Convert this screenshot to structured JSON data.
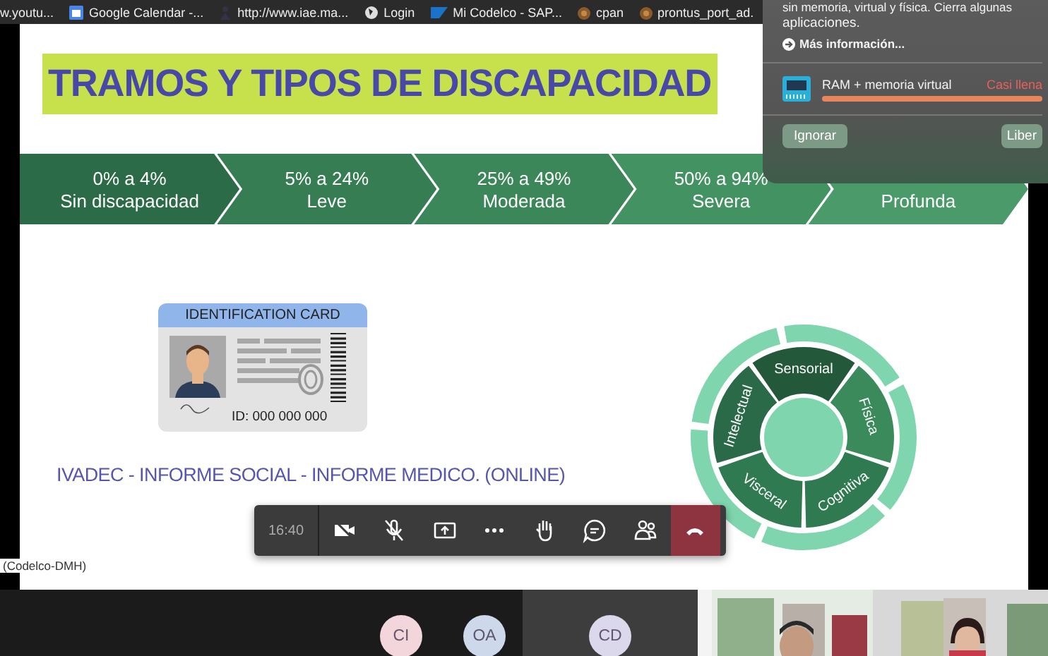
{
  "bookmarks": [
    {
      "label": "w.youtu...",
      "kind": "page"
    },
    {
      "label": "Google Calendar -...",
      "kind": "calendar"
    },
    {
      "label": "http://www.iae.ma...",
      "kind": "figure"
    },
    {
      "label": "Login",
      "kind": "globe"
    },
    {
      "label": "Mi Codelco - SAP...",
      "kind": "sap"
    },
    {
      "label": "cpan",
      "kind": "onion"
    },
    {
      "label": "prontus_port_ad.",
      "kind": "onion"
    }
  ],
  "slide": {
    "title": "TRAMOS Y TIPOS DE DISCAPACIDAD",
    "tramos": [
      {
        "range": "0% a 4%",
        "label": "Sin discapacidad",
        "color": "#2c6b47"
      },
      {
        "range": "5% a 24%",
        "label": "Leve",
        "color": "#367d53"
      },
      {
        "range": "25% a 49%",
        "label": "Moderada",
        "color": "#3c875a"
      },
      {
        "range": "50% a 94%",
        "label": "Severa",
        "color": "#439262"
      },
      {
        "label": "Profunda",
        "color": "#4a9b69"
      }
    ],
    "card": {
      "header": "IDENTIFICATION CARD",
      "id": "ID: 000 000 000"
    },
    "caption": "IVADEC - INFORME SOCIAL - INFORME MEDICO. (ONLINE)",
    "tipos": [
      {
        "label": "Sensorial",
        "color": "#24583b"
      },
      {
        "label": "Física",
        "color": "#3b8a5c"
      },
      {
        "label": "Cognitiva",
        "color": "#2f7a50"
      },
      {
        "label": "Visceral",
        "color": "#2f7a50"
      },
      {
        "label": "Intelectual",
        "color": "#2a6a48"
      }
    ]
  },
  "presenter_label": "(Codelco-DMH)",
  "notification": {
    "text_top": "sin memoria, virtual y física. Cierra algunas",
    "text": "aplicaciones.",
    "link": "Más información...",
    "resource": "RAM + memoria virtual",
    "status": "Casi llena",
    "level": 1,
    "buttons": [
      "Ignorar",
      "Liber"
    ]
  },
  "toolbar": {
    "time": "16:40",
    "buttons": [
      {
        "kind": "camera-off"
      },
      {
        "kind": "mic-off"
      },
      {
        "kind": "share"
      },
      {
        "kind": "more"
      },
      {
        "kind": "hand"
      },
      {
        "kind": "chat"
      },
      {
        "kind": "people"
      },
      {
        "kind": "hangup"
      }
    ]
  },
  "participants": [
    {
      "initials": "CI",
      "color": "#f2d6dc"
    },
    {
      "initials": "OA",
      "color": "#cdd8ea"
    },
    {
      "initials": "CD",
      "color": "#dcd8ec"
    }
  ]
}
